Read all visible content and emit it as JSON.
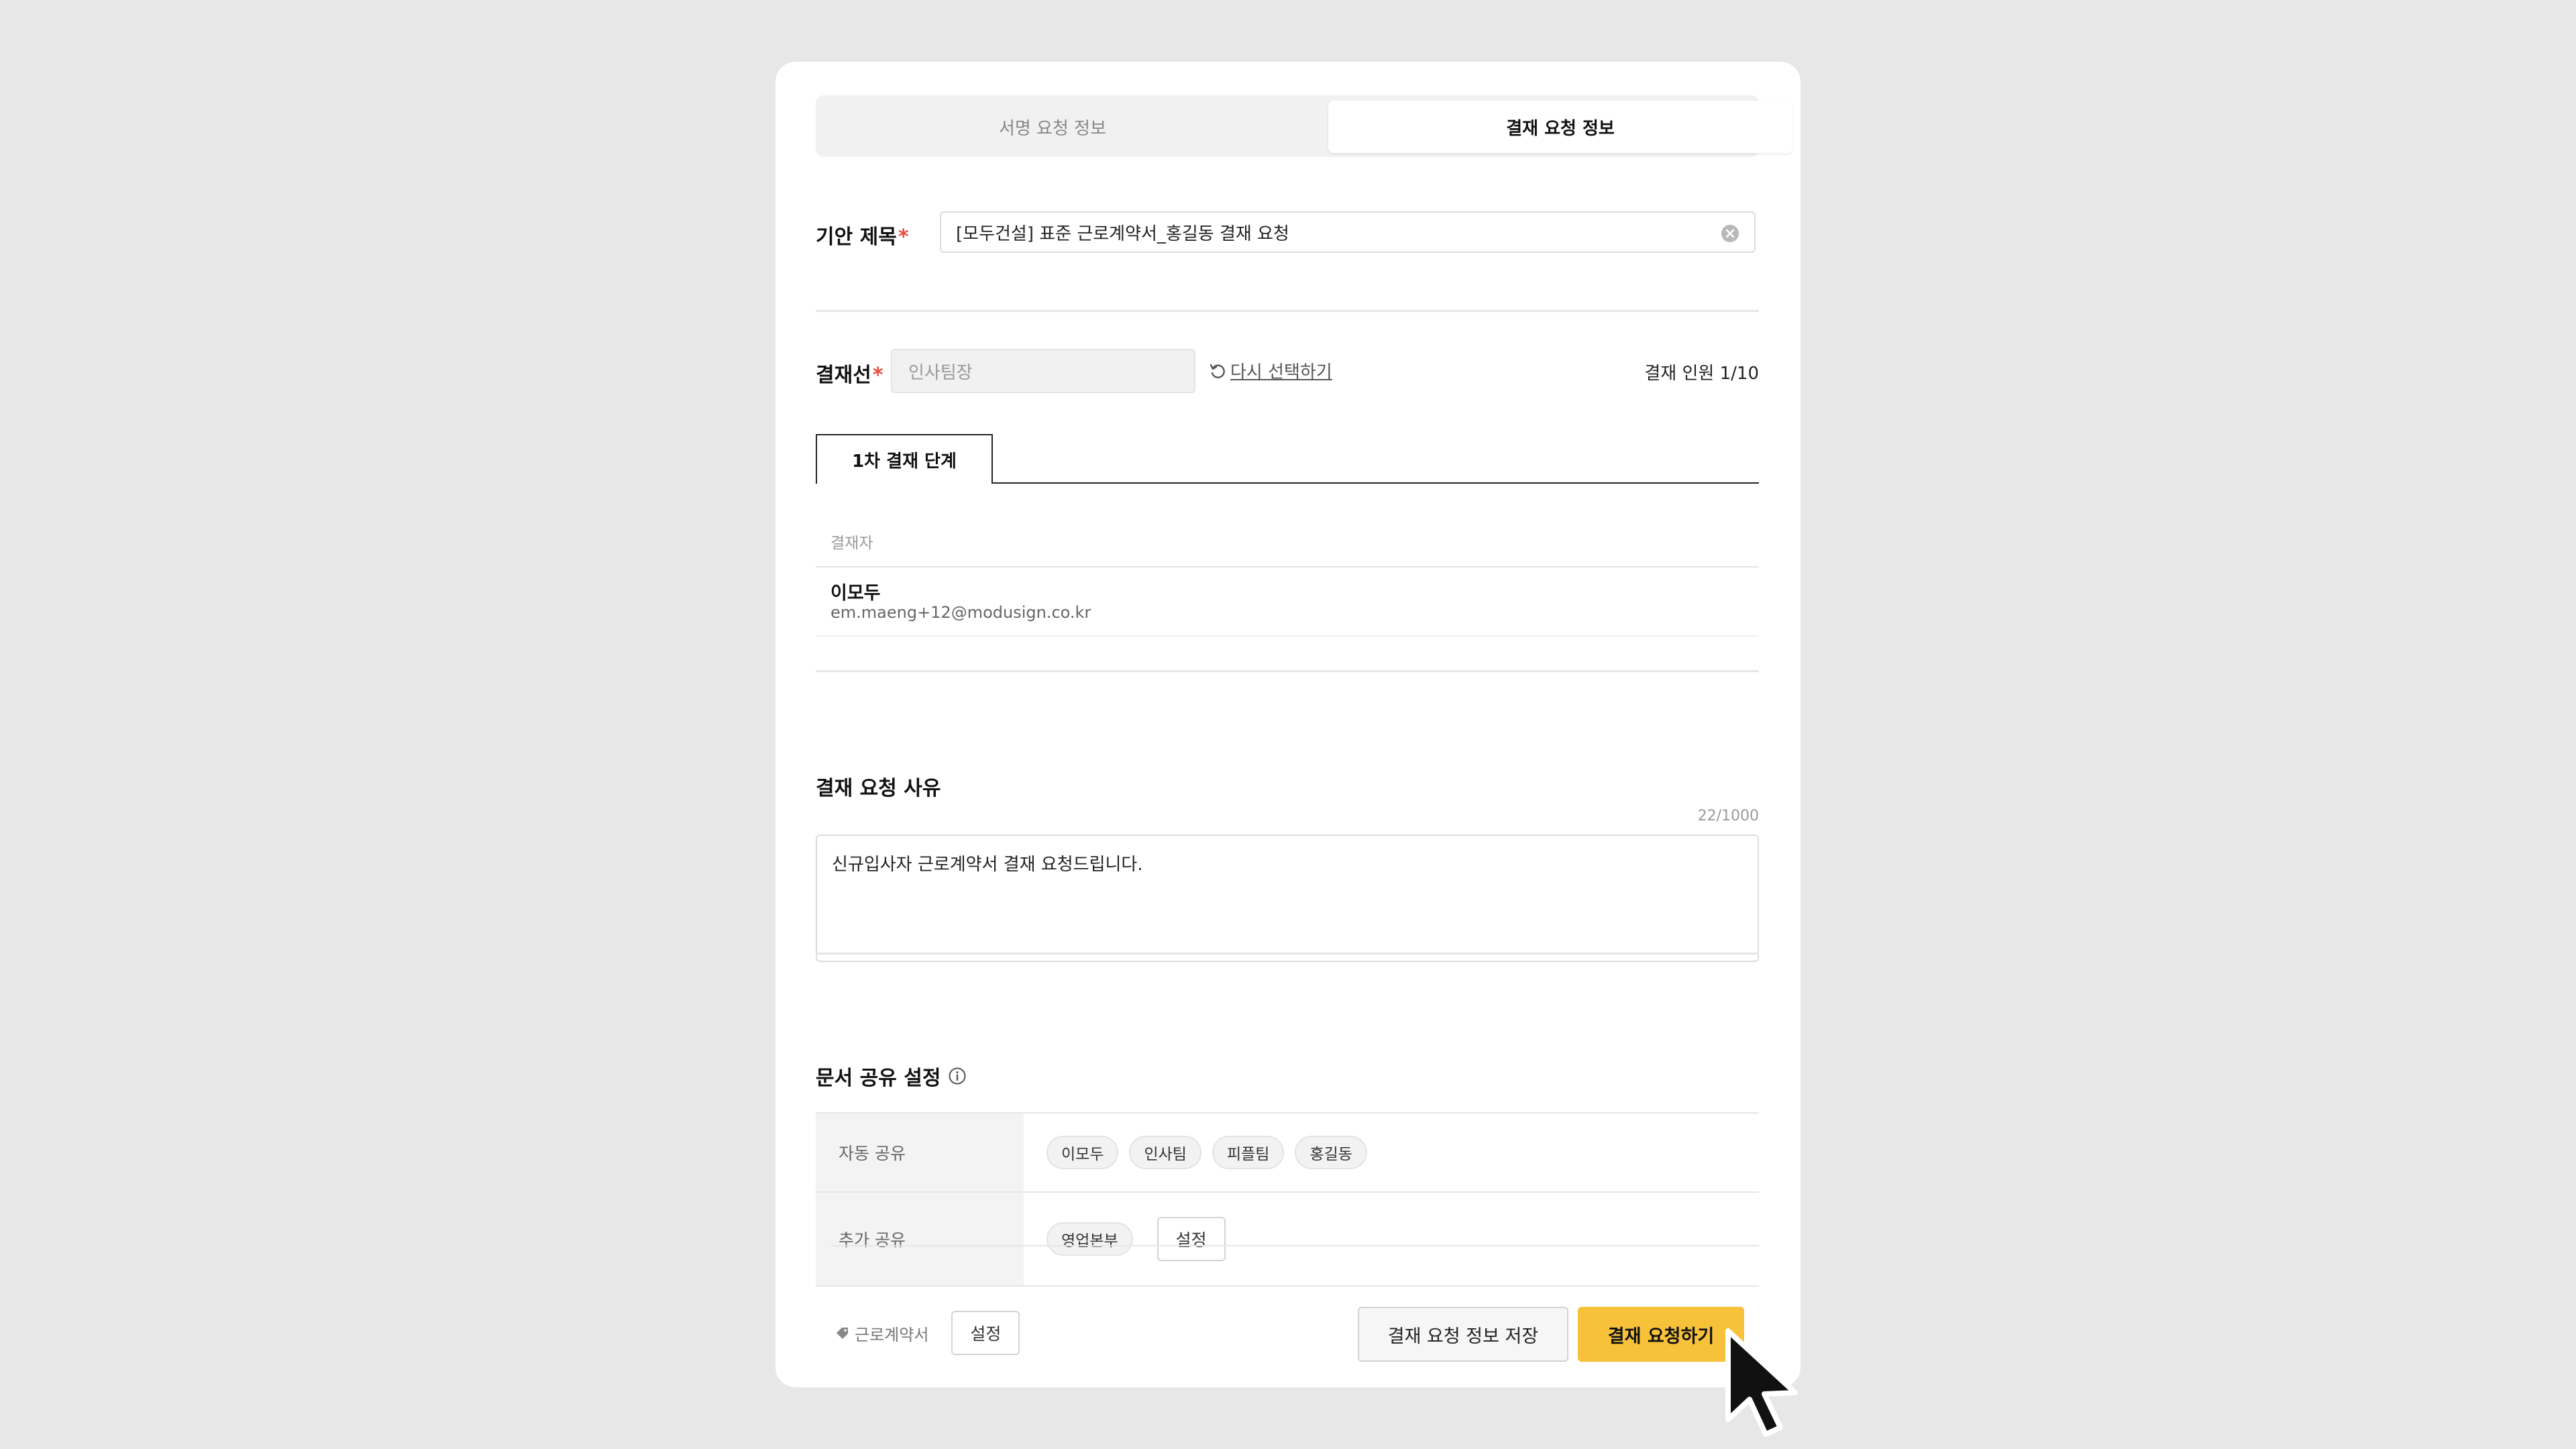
{
  "tabs": [
    {
      "label": "서명 요청 정보",
      "active": false
    },
    {
      "label": "결재 요청 정보",
      "active": true
    }
  ],
  "draft_title": {
    "label": "기안 제목",
    "required_mark": "*",
    "value": "[모두건설] 표준 근로계약서_홍길동 결재 요청"
  },
  "approval_line": {
    "label": "결재선",
    "required_mark": "*",
    "value": "인사팀장",
    "reselect_label": "다시 선택하기",
    "count_label": "결재 인원 1/10"
  },
  "step_tab": {
    "label": "1차 결재 단계"
  },
  "approvers": {
    "header": "결재자",
    "items": [
      {
        "name": "이모두",
        "email": "em.maeng+12@modusign.co.kr"
      }
    ]
  },
  "reason": {
    "title": "결재 요청 사유",
    "counter": "22/1000",
    "value": "신규입사자 근로계약서 결재 요청드립니다."
  },
  "sharing": {
    "title": "문서 공유 설정",
    "auto": {
      "label": "자동 공유",
      "chips": [
        "이모두",
        "인사팀",
        "피플팀",
        "홍길동"
      ]
    },
    "extra": {
      "label": "추가 공유",
      "chips": [
        "영업본부"
      ],
      "button": "설정"
    }
  },
  "footer": {
    "tag_label": "근로계약서",
    "tag_button": "설정",
    "save_button": "결재 요청 정보 저장",
    "request_button": "결재 요청하기"
  },
  "colors": {
    "primary": "#f7c23a",
    "required": "#e84b3c",
    "background": "#e7e7e7"
  },
  "icons": [
    "clear-icon",
    "refresh-icon",
    "info-icon",
    "tag-icon",
    "cursor-icon"
  ]
}
